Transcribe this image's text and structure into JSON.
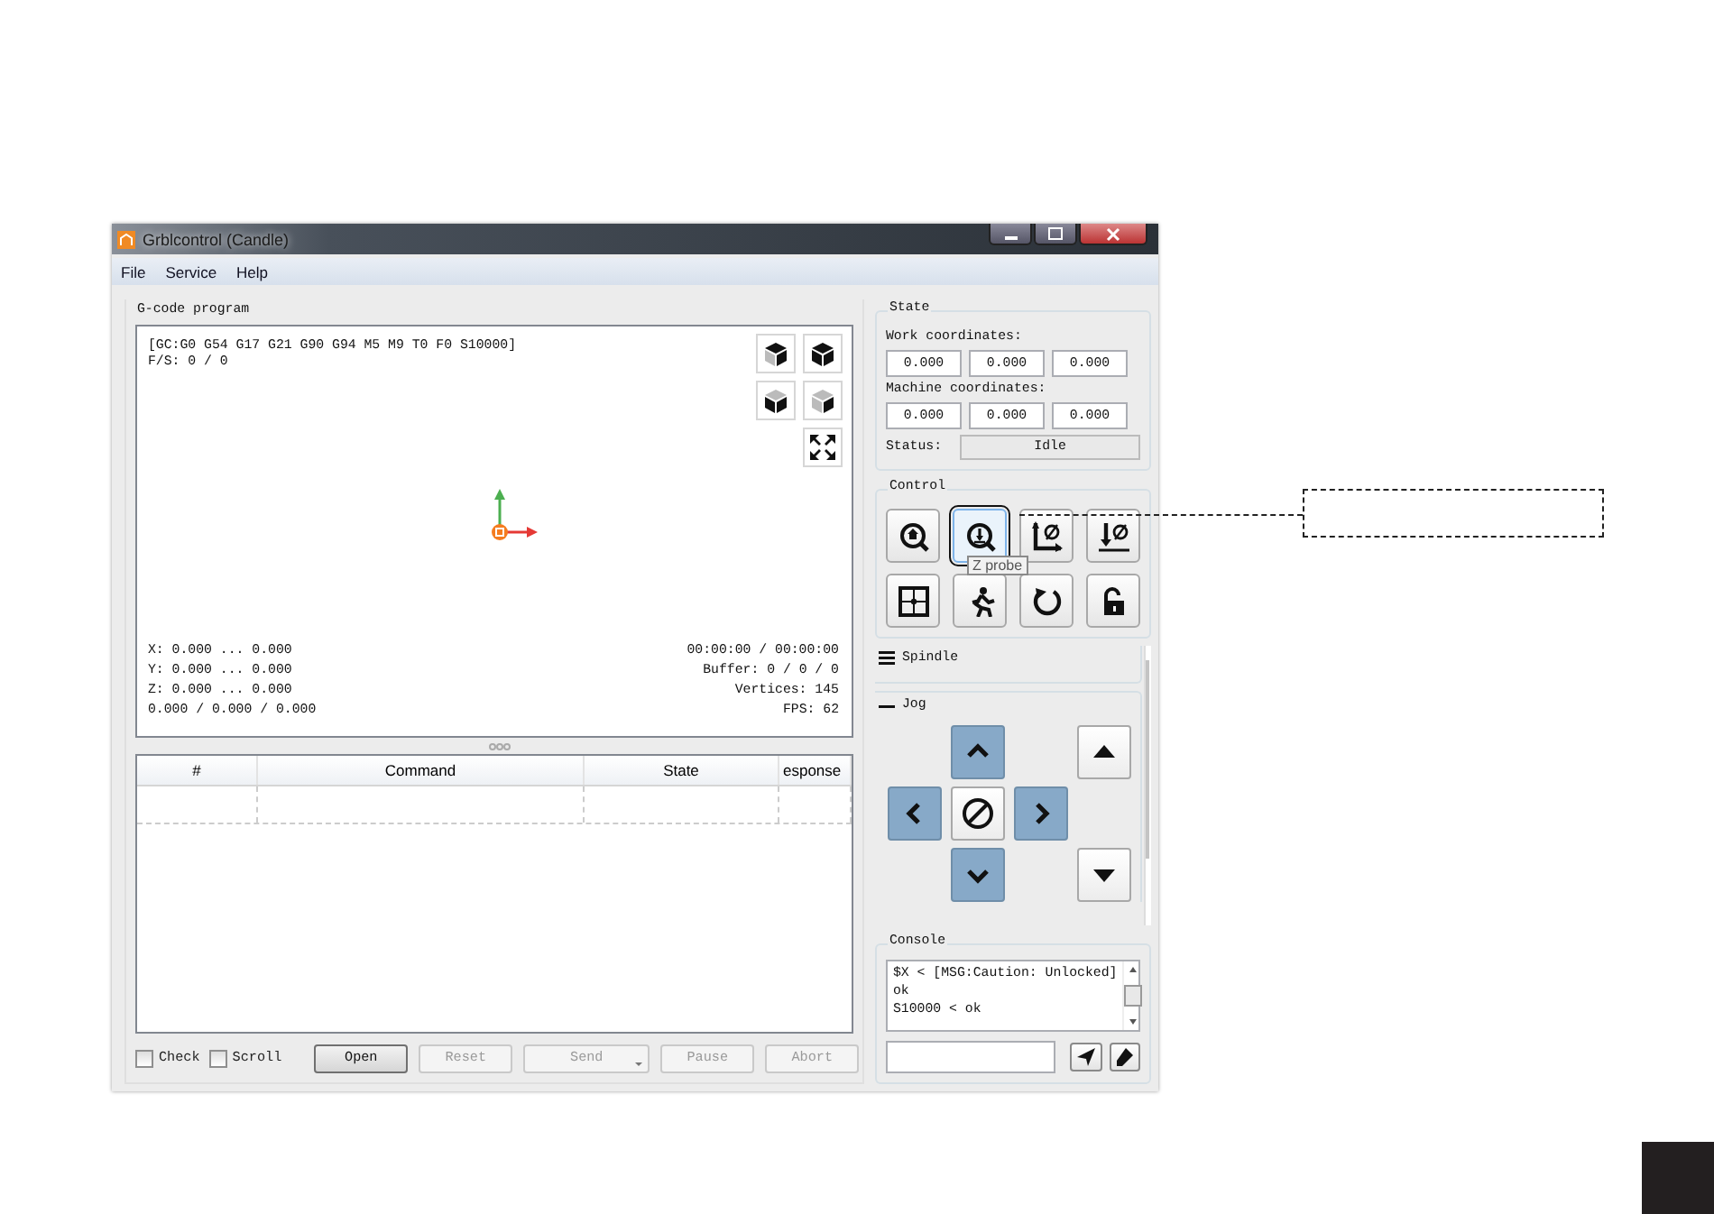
{
  "window": {
    "title": "Grblcontrol  (Candle)"
  },
  "menu": [
    {
      "label": "File"
    },
    {
      "label": "Service"
    },
    {
      "label": "Help"
    }
  ],
  "gcode_program": {
    "title": "G-code program",
    "parser_state": "[GC:G0 G54 G17 G21 G90 G94 M5 M9 T0 F0 S10000]",
    "feed_speed": "F/S: 0 / 0",
    "ranges": [
      "X: 0.000 ... 0.000",
      "Y: 0.000 ... 0.000",
      "Z: 0.000 ... 0.000",
      "0.000 / 0.000 / 0.000"
    ],
    "stats": [
      "00:00:00 / 00:00:00",
      "Buffer: 0 / 0 / 0",
      "Vertices: 145",
      "FPS: 62"
    ]
  },
  "table": {
    "columns": [
      "#",
      "Command",
      "State",
      "esponse"
    ]
  },
  "options": [
    {
      "label": "Check",
      "checked": false
    },
    {
      "label": "Scroll",
      "checked": false
    }
  ],
  "buttons": [
    {
      "label": "Open",
      "disabled": false,
      "kind": "plain"
    },
    {
      "label": "Reset",
      "disabled": true,
      "kind": "plain"
    },
    {
      "label": "Send",
      "disabled": true,
      "kind": "split"
    },
    {
      "label": "Pause",
      "disabled": true,
      "kind": "plain"
    },
    {
      "label": "Abort",
      "disabled": true,
      "kind": "plain"
    }
  ],
  "state": {
    "title": "State",
    "work_label": "Work coordinates:",
    "work": [
      "0.000",
      "0.000",
      "0.000"
    ],
    "machine_label": "Machine coordinates:",
    "machine": [
      "0.000",
      "0.000",
      "0.000"
    ],
    "status_label": "Status:",
    "status": "Idle"
  },
  "control": {
    "title": "Control",
    "buttons": [
      {
        "kind": "home",
        "hovered": false
      },
      {
        "kind": "probe",
        "hovered": true,
        "tooltip": "Z probe"
      },
      {
        "kind": "zero-xy",
        "hovered": false
      },
      {
        "kind": "zero-z",
        "hovered": false
      },
      {
        "kind": "frame",
        "hovered": false
      },
      {
        "kind": "run",
        "hovered": false
      },
      {
        "kind": "reset",
        "hovered": false
      },
      {
        "kind": "unlock",
        "hovered": false
      }
    ]
  },
  "spindle": {
    "title": "Spindle",
    "expanded": false
  },
  "jog": {
    "title": "Jog",
    "expanded": true,
    "buttons": [
      {
        "kind": "y-plus"
      },
      {
        "kind": "z-plus"
      },
      {
        "kind": "x-minus"
      },
      {
        "kind": "stop"
      },
      {
        "kind": "x-plus"
      },
      {
        "kind": "y-minus"
      },
      {
        "kind": "z-minus"
      }
    ]
  },
  "console": {
    "title": "Console",
    "lines": [
      "$X < [MSG:Caution: Unlocked]",
      "ok",
      "S10000 < ok"
    ]
  }
}
